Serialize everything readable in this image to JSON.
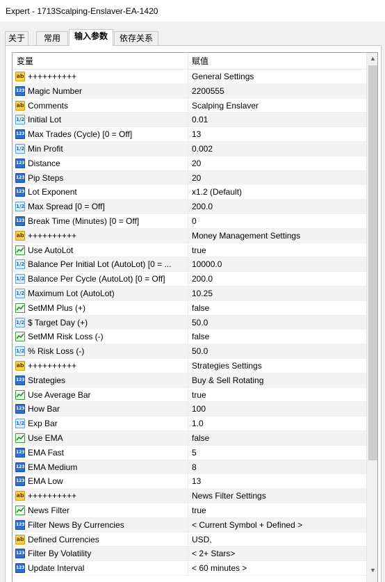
{
  "window": {
    "title": "Expert - 1713Scalping-Enslaver-EA-1420"
  },
  "tabs": [
    {
      "label": "关于",
      "active": false
    },
    {
      "label": "常用",
      "active": false
    },
    {
      "label": "输入参数",
      "active": true
    },
    {
      "label": "依存关系",
      "active": false
    }
  ],
  "grid": {
    "columns": {
      "variable": "变量",
      "value": "赋值"
    },
    "rows": [
      {
        "icon": "string-icon",
        "name": "++++++++++",
        "value": "General Settings"
      },
      {
        "icon": "integer-icon",
        "name": "Magic Number",
        "value": "2200555"
      },
      {
        "icon": "string-icon",
        "name": "Comments",
        "value": "Scalping Enslaver"
      },
      {
        "icon": "double-icon",
        "name": "Initial Lot",
        "value": "0.01"
      },
      {
        "icon": "integer-icon",
        "name": "Max Trades (Cycle) [0 = Off]",
        "value": "13"
      },
      {
        "icon": "double-icon",
        "name": "Min Profit",
        "value": "0.002"
      },
      {
        "icon": "integer-icon",
        "name": "Distance",
        "value": "20"
      },
      {
        "icon": "integer-icon",
        "name": "Pip Steps",
        "value": "20"
      },
      {
        "icon": "integer-icon",
        "name": "Lot Exponent",
        "value": "x1.2 (Default)"
      },
      {
        "icon": "double-icon",
        "name": "Max Spread [0 = Off]",
        "value": "200.0"
      },
      {
        "icon": "integer-icon",
        "name": "Break Time (Minutes) [0 = Off]",
        "value": "0"
      },
      {
        "icon": "string-icon",
        "name": "++++++++++",
        "value": "Money Management Settings"
      },
      {
        "icon": "bool-icon",
        "name": "Use AutoLot",
        "value": "true"
      },
      {
        "icon": "double-icon",
        "name": "Balance Per Initial Lot (AutoLot) [0 = ...",
        "value": "10000.0"
      },
      {
        "icon": "double-icon",
        "name": "Balance Per Cycle (AutoLot) [0 = Off]",
        "value": "200.0"
      },
      {
        "icon": "double-icon",
        "name": "Maximum Lot (AutoLot)",
        "value": "10.25"
      },
      {
        "icon": "bool-icon",
        "name": "SetMM Plus (+)",
        "value": "false"
      },
      {
        "icon": "double-icon",
        "name": "$ Target Day (+)",
        "value": "50.0"
      },
      {
        "icon": "bool-icon",
        "name": "SetMM Risk Loss (-)",
        "value": "false"
      },
      {
        "icon": "double-icon",
        "name": "% Risk Loss (-)",
        "value": "50.0"
      },
      {
        "icon": "string-icon",
        "name": "++++++++++",
        "value": "Strategies Settings"
      },
      {
        "icon": "integer-icon",
        "name": "Strategies",
        "value": "Buy & Sell Rotating"
      },
      {
        "icon": "bool-icon",
        "name": "Use Average Bar",
        "value": "true"
      },
      {
        "icon": "integer-icon",
        "name": "How Bar",
        "value": "100"
      },
      {
        "icon": "double-icon",
        "name": "Exp Bar",
        "value": "1.0"
      },
      {
        "icon": "bool-icon",
        "name": "Use EMA",
        "value": "false"
      },
      {
        "icon": "integer-icon",
        "name": "EMA Fast",
        "value": "5"
      },
      {
        "icon": "integer-icon",
        "name": "EMA Medium",
        "value": "8"
      },
      {
        "icon": "integer-icon",
        "name": "EMA Low",
        "value": "13"
      },
      {
        "icon": "string-icon",
        "name": "++++++++++",
        "value": "News Filter Settings"
      },
      {
        "icon": "bool-icon",
        "name": "News Filter",
        "value": "true"
      },
      {
        "icon": "integer-icon",
        "name": "Filter News By Currencies",
        "value": "< Current Symbol + Defined >"
      },
      {
        "icon": "string-icon",
        "name": "Defined Currencies",
        "value": "USD,"
      },
      {
        "icon": "integer-icon",
        "name": "Filter By Volatility",
        "value": "< 2+ Stars>"
      },
      {
        "icon": "integer-icon",
        "name": "Update Interval",
        "value": "< 60 minutes >"
      }
    ]
  },
  "icon_glyphs": {
    "string-icon": "ab",
    "integer-icon": "123",
    "double-icon": "1/2",
    "bool-icon": ""
  },
  "colors": {
    "selected_tab_bg": "#ffffff",
    "dialog_bg": "#f0f0f0",
    "row_alt": "#f3f3f3"
  }
}
